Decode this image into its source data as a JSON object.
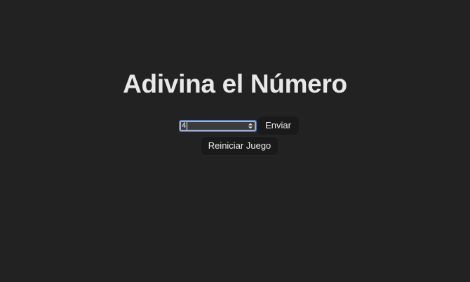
{
  "page": {
    "title": "Adivina el Número"
  },
  "guess_input": {
    "value": "4",
    "type": "number"
  },
  "buttons": {
    "send_label": "Enviar",
    "reset_label": "Reiniciar Juego"
  },
  "colors": {
    "background": "#222222",
    "text": "#e8e8e8",
    "button_bg": "#1a1a1a",
    "input_focus": "#9fb2d6"
  },
  "icons": {
    "spinner": "up-down-spinner-icon"
  }
}
